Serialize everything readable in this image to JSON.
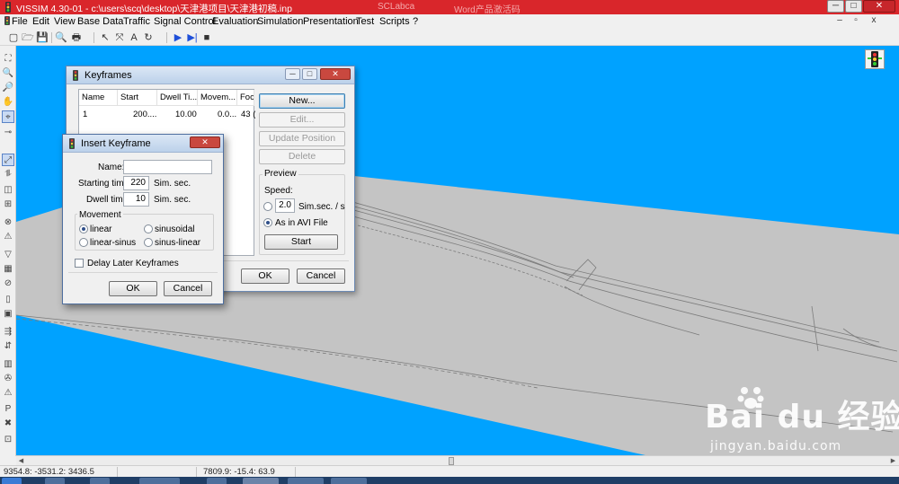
{
  "window": {
    "title": "VISSIM 4.30-01 - c:\\users\\scq\\desktop\\天津港项目\\天津港初稿.inp",
    "background_titles": [
      "SCLabca",
      "Word产品激活码"
    ],
    "controls": [
      "─",
      "□",
      "✕"
    ]
  },
  "menu": {
    "items": [
      {
        "label": "File",
        "enabled": true
      },
      {
        "label": "Edit",
        "enabled": true
      },
      {
        "label": "View",
        "enabled": true
      },
      {
        "label": "Base Data",
        "enabled": true
      },
      {
        "label": "Traffic",
        "enabled": true
      },
      {
        "label": "Signal Control",
        "enabled": true
      },
      {
        "label": "Evaluation",
        "enabled": true
      },
      {
        "label": "Simulation",
        "enabled": true
      },
      {
        "label": "Presentation",
        "enabled": true
      },
      {
        "label": "Test",
        "enabled": true
      },
      {
        "label": "Scripts",
        "enabled": true
      },
      {
        "label": "?",
        "enabled": true
      }
    ],
    "mdi_controls": [
      "–",
      "▫",
      "x"
    ]
  },
  "toolbar": {
    "icons": [
      "new-file-icon",
      "open-file-icon",
      "save-icon",
      "print-preview-icon",
      "print-icon",
      "select-arrow-icon",
      "multiselect-icon",
      "label-icon",
      "rotate-icon",
      "play-icon",
      "step-icon",
      "stop-icon"
    ],
    "glyphs": [
      "▢",
      "🗁",
      "💾",
      "🔍",
      "🖶",
      "↖",
      "⤧",
      "A",
      "↻",
      "▶",
      "▶|",
      "■"
    ]
  },
  "leftbar": {
    "glyphs": [
      "⛶",
      "🔍",
      "🔎",
      "✋",
      "⌖",
      "⊸",
      "⤢",
      "⥮",
      "◫",
      "⊞",
      "⊗",
      "⚠",
      "▽",
      "▦",
      "⊘",
      "▯",
      "▣",
      "⇶",
      "⇵",
      "▥",
      "✇",
      "⚠",
      "P",
      "✖",
      "⊡"
    ]
  },
  "watermark": {
    "brand": "Bai du 经验",
    "url": "jingyan.baidu.com"
  },
  "statusbar": {
    "coords_left": "9354.8: -3531.2: 3436.5",
    "coords_right": "7809.9: -15.4: 63.9"
  },
  "keyframes_dialog": {
    "title": "Keyframes",
    "columns": [
      "Name",
      "Start",
      "Dwell Ti...",
      "Movem...",
      "Foc"
    ],
    "rows": [
      [
        "1",
        "200....",
        "10.00",
        "0.0...",
        "43 ("
      ]
    ],
    "buttons": {
      "new": "New...",
      "edit": "Edit...",
      "update_position": "Update Position",
      "delete": "Delete",
      "ok": "OK",
      "cancel": "Cancel"
    },
    "preview": {
      "group_title": "Preview",
      "speed_label": "Speed:",
      "speed_value": "2.0",
      "speed_unit": "Sim.sec. / s",
      "avi_label": "As in AVI File",
      "start": "Start",
      "selected": "As in AVI File"
    }
  },
  "insert_dialog": {
    "title": "Insert Keyframe",
    "name_label": "Name:",
    "name_value": "",
    "start_label": "Starting time:",
    "start_value": "220",
    "start_unit": "Sim. sec.",
    "dwell_label": "Dwell time:",
    "dwell_value": "10",
    "dwell_unit": "Sim. sec.",
    "movement_title": "Movement",
    "movement_options": [
      "linear",
      "sinusoidal",
      "linear-sinus",
      "sinus-linear"
    ],
    "movement_selected": "linear",
    "delay_label": "Delay Later Keyframes",
    "delay_checked": false,
    "ok": "OK",
    "cancel": "Cancel"
  },
  "colors": {
    "title_bar": "#d9262b",
    "viewport_sky": "#00a2ff",
    "ground": "#c4c4c4",
    "dialog_title": "#bcd1ea"
  }
}
